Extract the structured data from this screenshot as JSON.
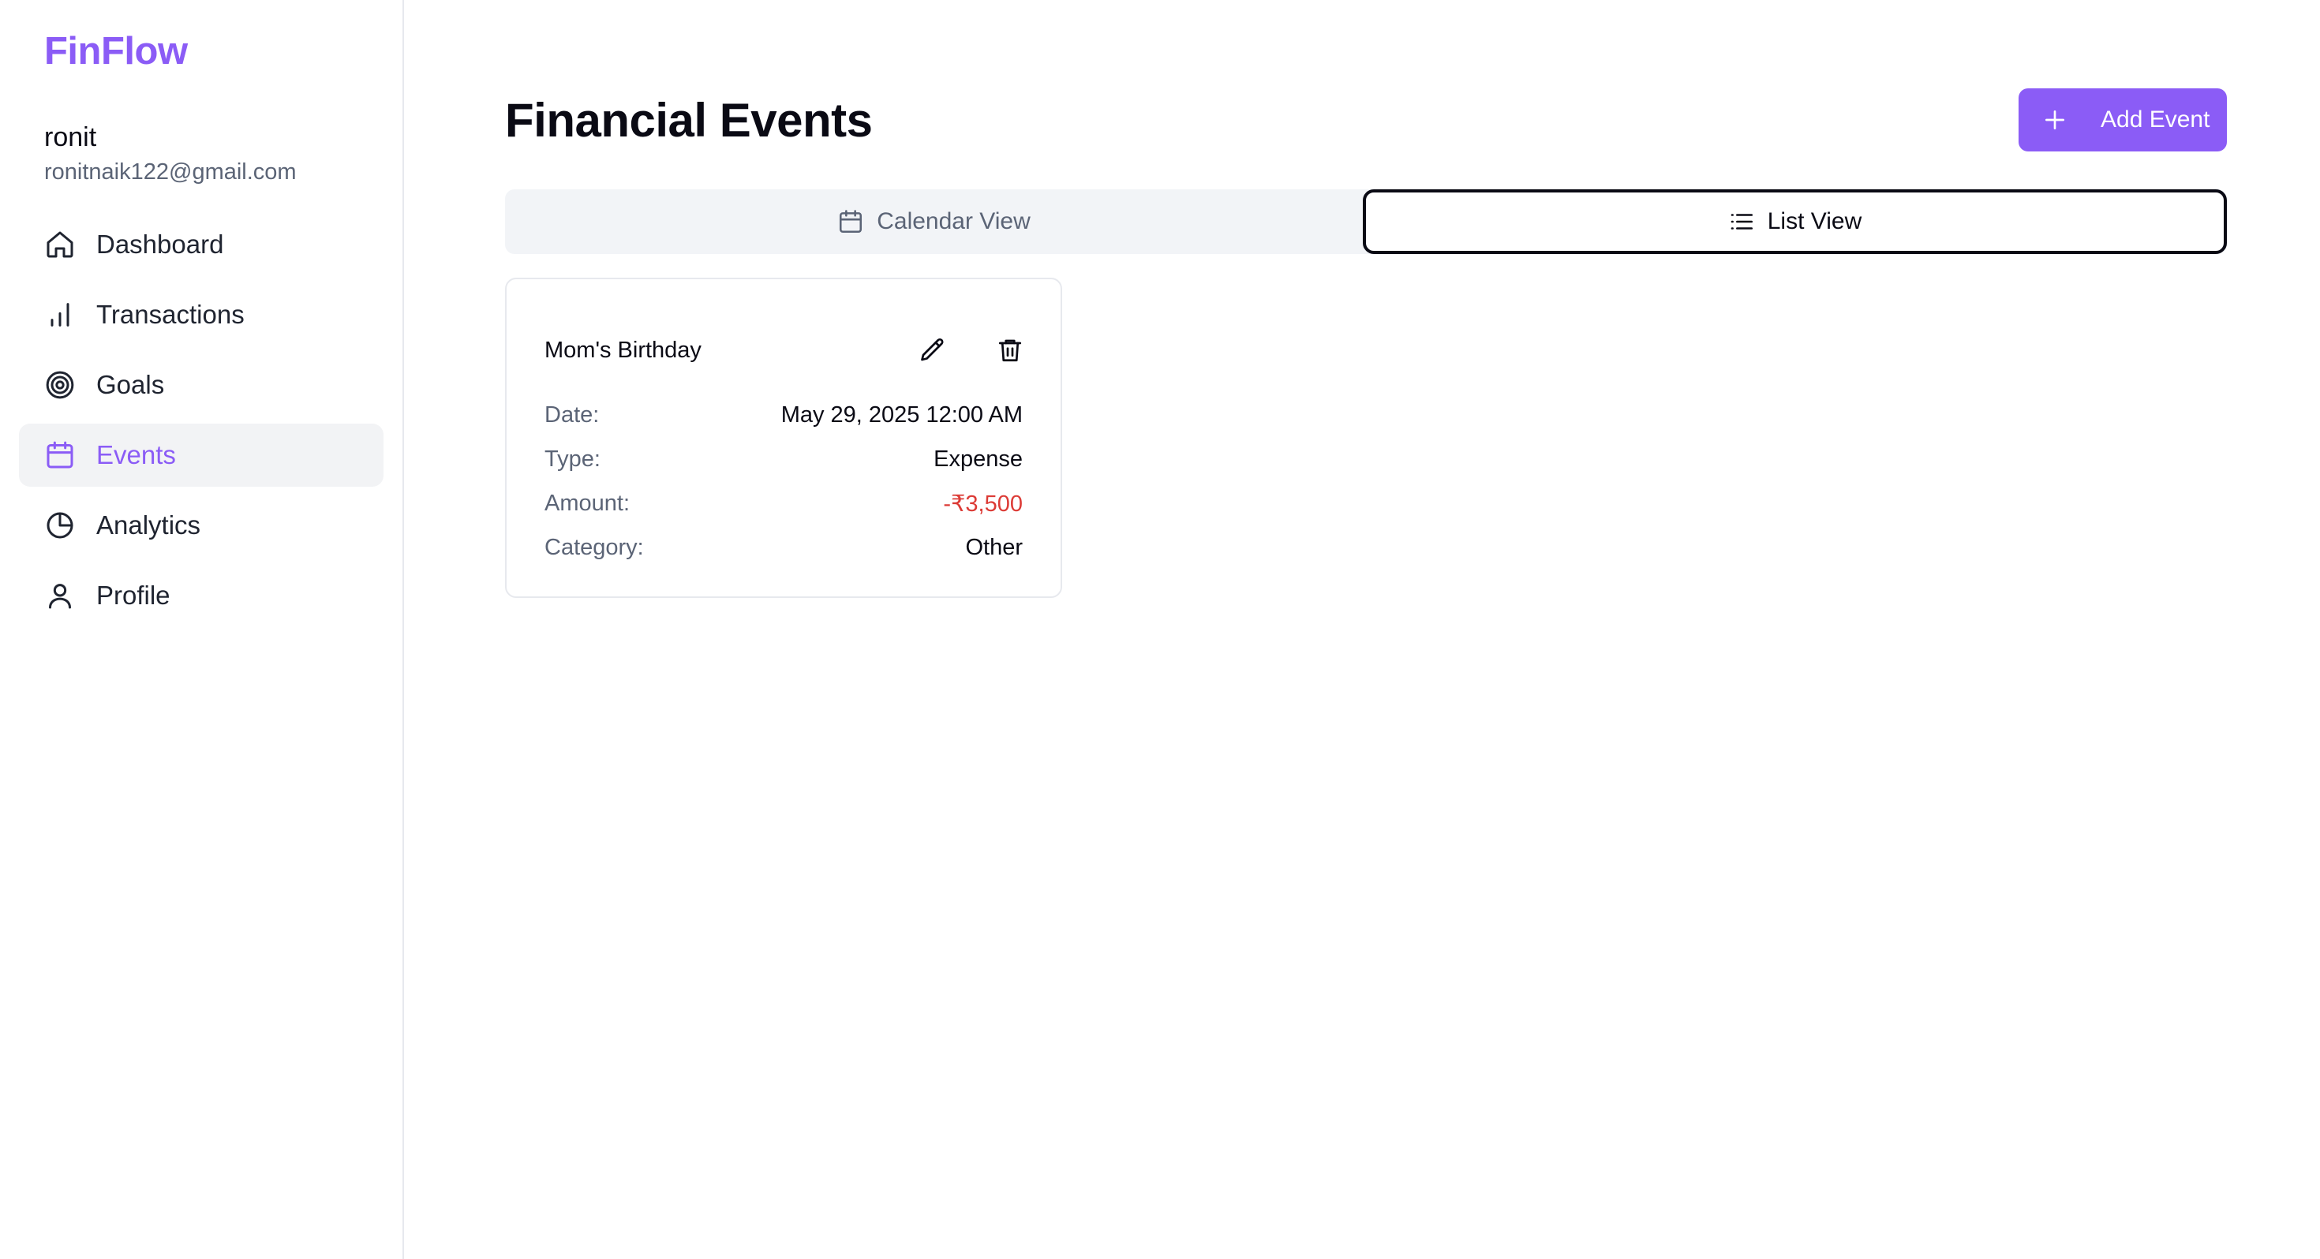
{
  "brand": "FinFlow",
  "user": {
    "name": "ronit",
    "email": "ronitnaik122@gmail.com"
  },
  "nav": {
    "items": [
      {
        "label": "Dashboard",
        "icon": "home-icon"
      },
      {
        "label": "Transactions",
        "icon": "bar-chart-icon"
      },
      {
        "label": "Goals",
        "icon": "target-icon"
      },
      {
        "label": "Events",
        "icon": "calendar-icon",
        "active": true
      },
      {
        "label": "Analytics",
        "icon": "pie-chart-icon"
      },
      {
        "label": "Profile",
        "icon": "user-icon"
      }
    ]
  },
  "header": {
    "title": "Financial Events",
    "add_label": "Add Event"
  },
  "tabs": [
    {
      "label": "Calendar View",
      "icon": "calendar-icon"
    },
    {
      "label": "List View",
      "icon": "list-icon",
      "active": true
    }
  ],
  "events": [
    {
      "title": "Mom's Birthday",
      "fields": [
        {
          "label": "Date:",
          "value": "May 29, 2025 12:00 AM"
        },
        {
          "label": "Type:",
          "value": "Expense"
        },
        {
          "label": "Amount:",
          "value": "-₹3,500"
        },
        {
          "label": "Category:",
          "value": "Other"
        }
      ]
    }
  ],
  "colors": {
    "accent": "#8b5cf6",
    "negative": "#dc3b36",
    "muted": "#5b6476"
  }
}
